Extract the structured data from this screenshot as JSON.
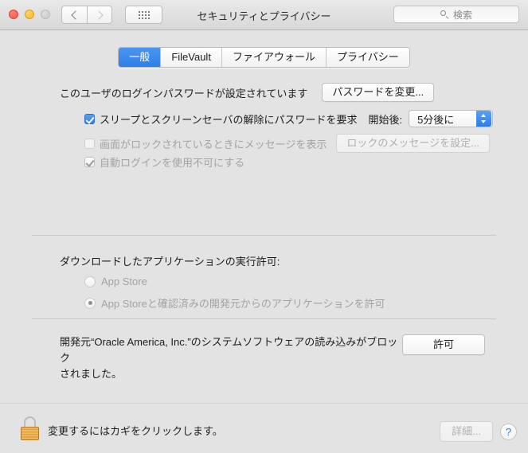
{
  "window": {
    "title": "セキュリティとプライバシー",
    "traffic_lights": [
      "close",
      "minimize",
      "zoom"
    ],
    "nav": {
      "back": "back-chevron",
      "forward": "forward-chevron",
      "show_all": "grid-icon"
    },
    "search": {
      "placeholder": "検索",
      "icon": "search-icon"
    }
  },
  "tabs": [
    {
      "label": "一般",
      "active": true
    },
    {
      "label": "FileVault",
      "active": false
    },
    {
      "label": "ファイアウォール",
      "active": false
    },
    {
      "label": "プライバシー",
      "active": false
    }
  ],
  "general": {
    "password_status": "このユーザのログインパスワードが設定されています",
    "change_password_button": "パスワードを変更...",
    "require_password": {
      "label": "スリープとスクリーンセーバの解除にパスワードを要求",
      "checked": true,
      "delay_label": "開始後:",
      "delay_value": "5分後に"
    },
    "lock_message": {
      "label": "画面がロックされているときにメッセージを表示",
      "checked": false,
      "button": "ロックのメッセージを設定..."
    },
    "disable_auto_login": {
      "label": "自動ログインを使用不可にする",
      "checked": true
    }
  },
  "app_download": {
    "heading": "ダウンロードしたアプリケーションの実行許可:",
    "options": [
      {
        "label": "App Store",
        "selected": false
      },
      {
        "label": "App Storeと確認済みの開発元からのアプリケーションを許可",
        "selected": true
      }
    ]
  },
  "blocked_software": {
    "message_line1": "開発元“Oracle America, Inc.”のシステムソフトウェアの読み込みがブロック",
    "message_line2": "されました。",
    "allow_button": "許可"
  },
  "footer": {
    "lock_icon": "lock-closed-icon",
    "lock_text": "変更するにはカギをクリックします。",
    "advanced_button": "詳細...",
    "help_button": "?"
  },
  "colors": {
    "accent_blue": "#2f7fe8",
    "window_bg": "#e3e3e3",
    "text": "#1d1d1d",
    "disabled_text": "#a3a3a3",
    "lock_gold": "#e2a444"
  }
}
